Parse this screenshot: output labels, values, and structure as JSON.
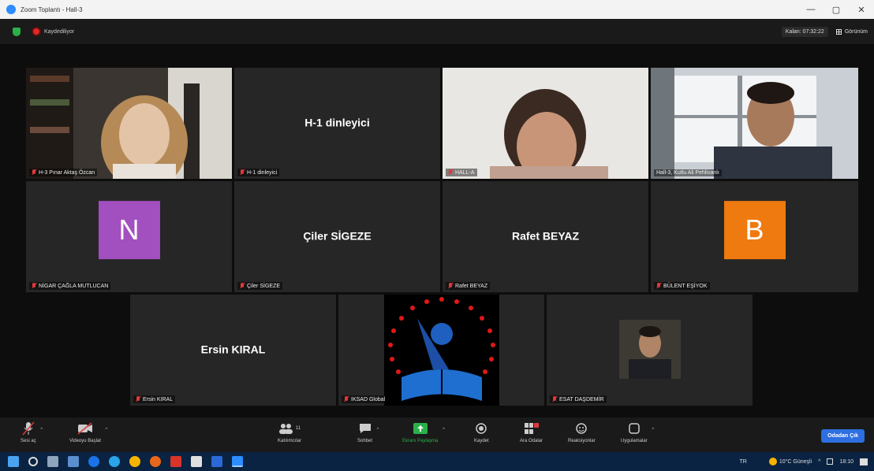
{
  "window": {
    "title": "Zoom Toplantı - Hall-3",
    "min": "—",
    "max": "▢",
    "close": "✕"
  },
  "topbar": {
    "recording": "Kaydediliyor",
    "timer": "Kalan: 07:32:22",
    "view": "Görünüm"
  },
  "tiles": [
    {
      "name": "H-3 Pınar Aktaş Özcan",
      "kind": "video"
    },
    {
      "name": "H-1 dinleyici",
      "display": "H-1 dinleyici",
      "kind": "text"
    },
    {
      "name": "HALL-A",
      "kind": "video"
    },
    {
      "name": "Hall-3, Kutlu Ali Pehlivanlı",
      "kind": "video",
      "active": true
    },
    {
      "name": "NİGAR ÇAĞLA MUTLUCAN",
      "initial": "N",
      "color": "#a24fbf",
      "kind": "avatar"
    },
    {
      "name": "Çiler SİGEZE",
      "display": "Çiler SİGEZE",
      "kind": "text"
    },
    {
      "name": "Rafet BEYAZ",
      "display": "Rafet BEYAZ",
      "kind": "text"
    },
    {
      "name": "BÜLENT EŞİYOK",
      "initial": "B",
      "color": "#ef7a0f",
      "kind": "avatar"
    },
    {
      "name": "Ersin KIRAL",
      "display": "Ersin KIRAL",
      "kind": "text"
    },
    {
      "name": "IKSAD Global",
      "kind": "logo"
    },
    {
      "name": "ESAT DAŞDEMİR",
      "kind": "video"
    }
  ],
  "toolbar": {
    "mute": "Sesi aç",
    "video": "Videoyu Başlat",
    "participants": "Katılımcılar",
    "participants_count": "11",
    "chat": "Sohbet",
    "share": "Ekranı Paylaşma",
    "record": "Kaydet",
    "breakout": "Ara Odalar",
    "reactions": "Reaksiyonlar",
    "apps": "Uygulamalar",
    "leave": "Odadan Çık"
  },
  "taskbar": {
    "lang": "TR",
    "weather": "10°C  Güneşli",
    "time": "18:10"
  },
  "colors": {
    "active_speaker": "#b9d34a",
    "leave": "#2d6fe0",
    "share": "#2ab04a",
    "mic_off": "#e03a3a"
  }
}
